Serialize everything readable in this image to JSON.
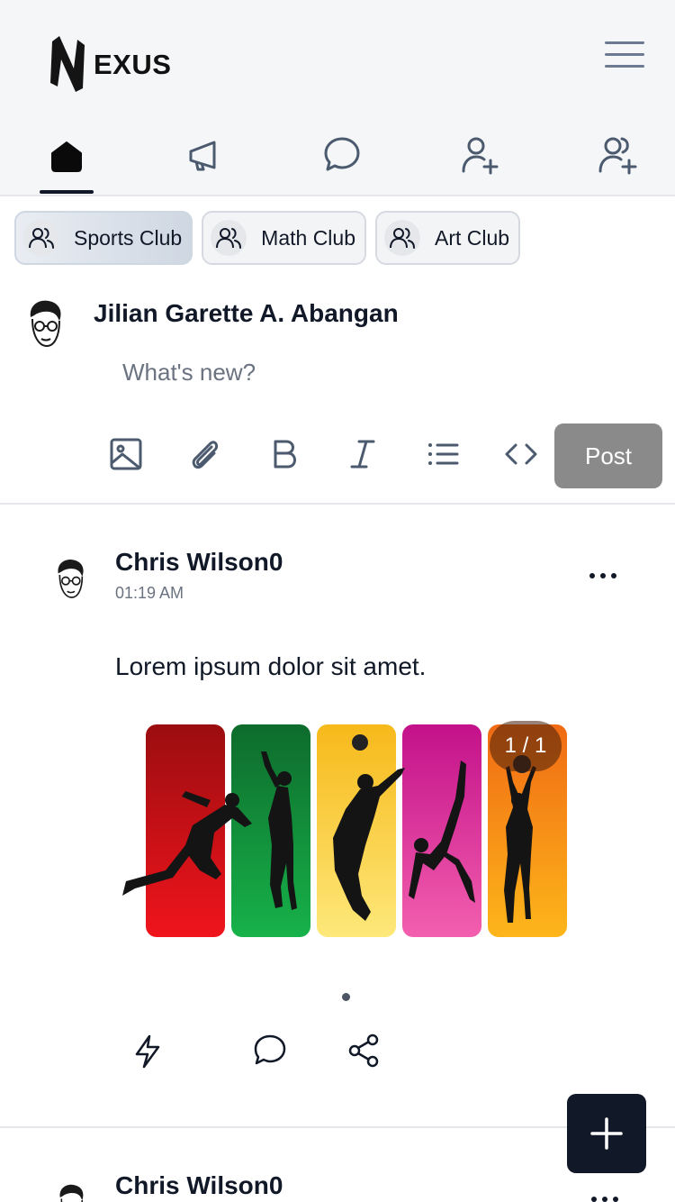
{
  "app": {
    "logo_text": "EXUS"
  },
  "nav": {
    "items": [
      "home",
      "announcements",
      "messages",
      "add-friend",
      "friend-requests"
    ]
  },
  "clubs": [
    {
      "label": "Sports Club",
      "active": true
    },
    {
      "label": "Math Club",
      "active": false
    },
    {
      "label": "Art Club",
      "active": false
    }
  ],
  "composer": {
    "user_name": "Jilian Garette A. Abangan",
    "placeholder": "What's new?",
    "post_label": "Post"
  },
  "post": {
    "author": "Chris Wilson0",
    "time": "01:19 AM",
    "text": "Lorem ipsum dolor sit amet.",
    "image_counter": "1 / 1"
  },
  "post2": {
    "author": "Chris Wilson0"
  },
  "colors": {
    "brand": "#111827",
    "post_button": "#8a8a8a",
    "muted": "#6b7280"
  }
}
